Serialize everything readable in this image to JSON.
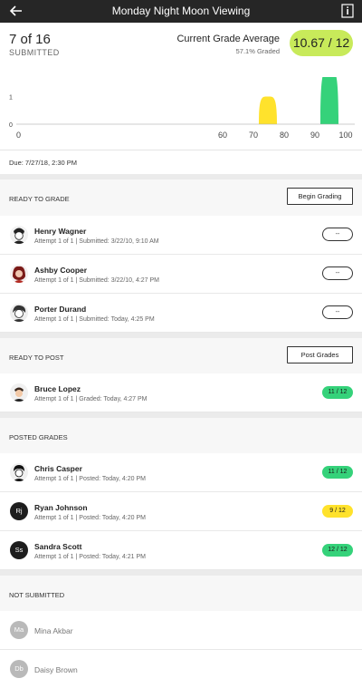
{
  "header": {
    "title": "Monday Night Moon Viewing",
    "back_icon": "arrow-left-icon",
    "info_icon": "info-doc-icon"
  },
  "summary": {
    "count": "7 of 16",
    "submitted_label": "SUBMITTED",
    "average_label": "Current Grade Average",
    "graded_label": "57.1% Graded",
    "average_value": "10.67 / 12",
    "average_color": "#c8ea5a"
  },
  "chart_data": {
    "type": "area",
    "x_ticks": [
      0,
      60,
      70,
      80,
      90,
      100
    ],
    "y_ticks": [
      0,
      1,
      2
    ],
    "xlim": [
      0,
      100
    ],
    "ylim": [
      0,
      2
    ],
    "series": [
      {
        "x_range": [
          70,
          80
        ],
        "peak": 1,
        "color": "#ffe22c"
      },
      {
        "x_range": [
          90,
          100
        ],
        "peak": 2,
        "color": "#35d27a"
      }
    ]
  },
  "due": "Due: 7/27/18, 2:30 PM",
  "ready_to_grade": {
    "label": "READY TO GRADE",
    "button": "Begin Grading",
    "rows": [
      {
        "name": "Henry Wagner",
        "meta": "Attempt 1 of 1 | Submitted: 3/22/10, 9:10 AM",
        "grade": "--"
      },
      {
        "name": "Ashby Cooper",
        "meta": "Attempt 1 of 1 | Submitted: 3/22/10, 4:27 PM",
        "grade": "--"
      },
      {
        "name": "Porter Durand",
        "meta": "Attempt 1 of 1 | Submitted: Today, 4:25 PM",
        "grade": "--"
      }
    ]
  },
  "ready_to_post": {
    "label": "READY TO POST",
    "button": "Post Grades",
    "rows": [
      {
        "name": "Bruce Lopez",
        "meta": "Attempt 1 of 1 | Graded: Today, 4:27 PM",
        "grade": "11 / 12"
      }
    ]
  },
  "posted": {
    "label": "POSTED GRADES",
    "rows": [
      {
        "name": "Chris Casper",
        "meta": "Attempt 1 of 1 | Posted: Today, 4:20 PM",
        "grade": "11 / 12"
      },
      {
        "name": "Ryan Johnson",
        "initials": "Rj",
        "meta": "Attempt 1 of 1 | Posted: Today, 4:20 PM",
        "grade": "9 / 12"
      },
      {
        "name": "Sandra Scott",
        "initials": "Ss",
        "meta": "Attempt 1 of 1 | Posted: Today, 4:21 PM",
        "grade": "12 / 12"
      }
    ]
  },
  "not_submitted": {
    "label": "NOT SUBMITTED",
    "rows": [
      {
        "name": "Mina Akbar",
        "initials": "Ma"
      },
      {
        "name": "Daisy Brown",
        "initials": "Db"
      }
    ]
  }
}
